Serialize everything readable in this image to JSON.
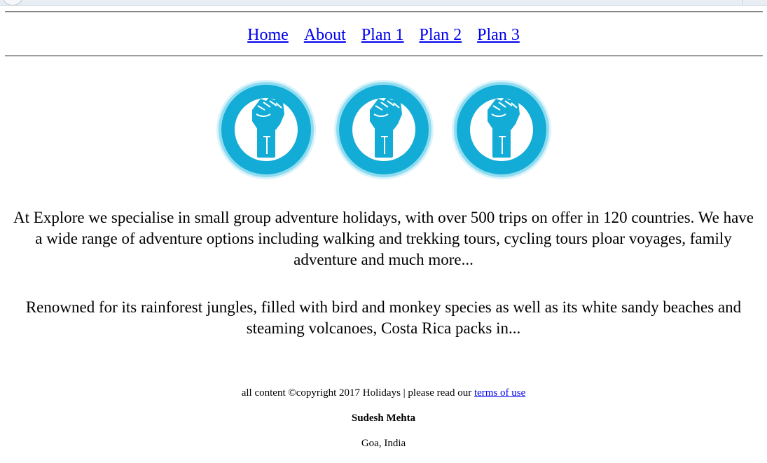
{
  "nav": {
    "items": [
      {
        "label": "Home"
      },
      {
        "label": "About"
      },
      {
        "label": "Plan 1"
      },
      {
        "label": "Plan 2"
      },
      {
        "label": "Plan 3"
      }
    ]
  },
  "icons": [
    {
      "name": "raised-fist-icon"
    },
    {
      "name": "raised-fist-icon"
    },
    {
      "name": "raised-fist-icon"
    }
  ],
  "colors": {
    "icon_ring": "#12acd6",
    "icon_glow": "#8fdcf0",
    "link": "#0000ee"
  },
  "content": {
    "paragraph_1": "At Explore we specialise in small group adventure holidays, with over 500 trips on offer in 120 countries. We have a wide range of adventure options including walking and trekking tours, cycling tours ploar voyages, family adventure and much more...",
    "paragraph_2": "Renowned for its rainforest jungles, filled with bird and monkey species as well as its white sandy beaches and steaming volcanoes, Costa Rica packs in..."
  },
  "footer": {
    "copyright_text": "all content ©copyright 2017 Holidays | please read our ",
    "terms_link": "terms of use",
    "author": "Sudesh Mehta",
    "location": "Goa, India"
  }
}
